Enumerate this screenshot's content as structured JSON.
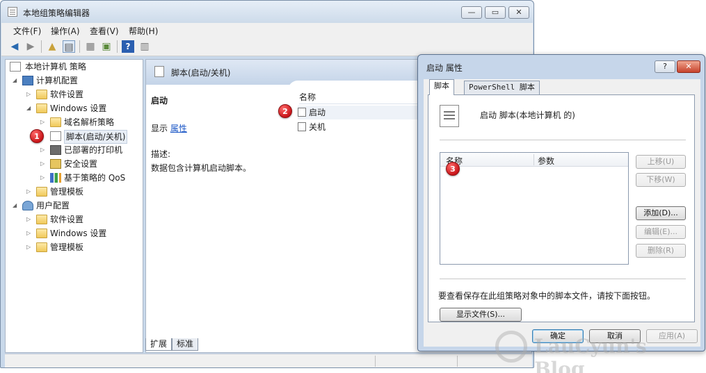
{
  "main": {
    "title": "本地组策略编辑器",
    "window_buttons": {
      "min": "—",
      "max": "▭",
      "close": "✕"
    },
    "menu": [
      "文件(F)",
      "操作(A)",
      "查看(V)",
      "帮助(H)"
    ],
    "toolbar_icons": [
      "back-arrow-icon",
      "forward-arrow-icon",
      "up-folder-icon",
      "show-hide-tree-icon",
      "export-list-icon",
      "properties-icon",
      "help-icon",
      "console-icon"
    ]
  },
  "tree": {
    "root": "本地计算机 策略",
    "computer": "计算机配置",
    "software": "软件设置",
    "windows_settings": "Windows 设置",
    "dns": "域名解析策略",
    "scripts": "脚本(启动/关机)",
    "printers": "已部署的打印机",
    "security": "安全设置",
    "qos": "基于策略的 QoS",
    "admin_templates": "管理模板",
    "user": "用户配置",
    "user_software": "软件设置",
    "user_windows": "Windows 设置",
    "user_admin": "管理模板"
  },
  "middle": {
    "header": "脚本(启动/关机)",
    "section_title": "启动",
    "show_prefix": "显示",
    "show_link": "属性",
    "desc_label": "描述:",
    "desc_text": "数据包含计算机启动脚本。",
    "col_name": "名称",
    "items": [
      "启动",
      "关机"
    ],
    "tab_extended": "扩展",
    "tab_standard": "标准"
  },
  "badges": [
    "1",
    "2",
    "3"
  ],
  "dialog": {
    "title": "启动 属性",
    "help_btn": "?",
    "close_btn": "✕",
    "tab_scripts": "脚本",
    "tab_powershell": "PowerShell 脚本",
    "heading": "启动 脚本(本地计算机 的)",
    "col_name": "名称",
    "col_params": "参数",
    "btn_up": "上移(U)",
    "btn_down": "下移(W)",
    "btn_add": "添加(D)...",
    "btn_edit": "编辑(E)...",
    "btn_remove": "删除(R)",
    "hint": "要查看保存在此组策略对象中的脚本文件，请按下面按钮。",
    "btn_show_files": "显示文件(S)...",
    "btn_ok": "确定",
    "btn_cancel": "取消",
    "btn_apply": "应用(A)"
  },
  "watermark": "LauCyun's Blog"
}
